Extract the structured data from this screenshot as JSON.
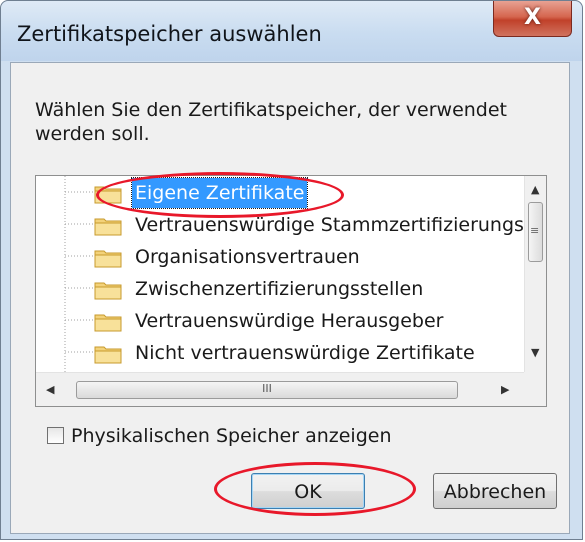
{
  "window": {
    "title": "Zertifikatspeicher auswählen",
    "close_label": "X"
  },
  "dialog": {
    "instructions": "Wählen Sie den Zertifikatspeicher, der verwendet werden soll."
  },
  "tree": {
    "items": [
      {
        "label": "Eigene Zertifikate",
        "selected": true
      },
      {
        "label": "Vertrauenswürdige Stammzertifizierungss",
        "selected": false
      },
      {
        "label": "Organisationsvertrauen",
        "selected": false
      },
      {
        "label": "Zwischenzertifizierungsstellen",
        "selected": false
      },
      {
        "label": "Vertrauenswürdige Herausgeber",
        "selected": false
      },
      {
        "label": "Nicht vertrauenswürdige Zertifikate",
        "selected": false
      }
    ],
    "hscroll_grip": "III",
    "vscroll_grip": "≡"
  },
  "options": {
    "physical_store_label": "Physikalischen Speicher anzeigen",
    "physical_store_checked": false
  },
  "buttons": {
    "ok_label": "OK",
    "cancel_label": "Abbrechen"
  },
  "colors": {
    "selection": "#3399ff",
    "annotation": "#e8182a",
    "close_button": "#c1412a"
  }
}
